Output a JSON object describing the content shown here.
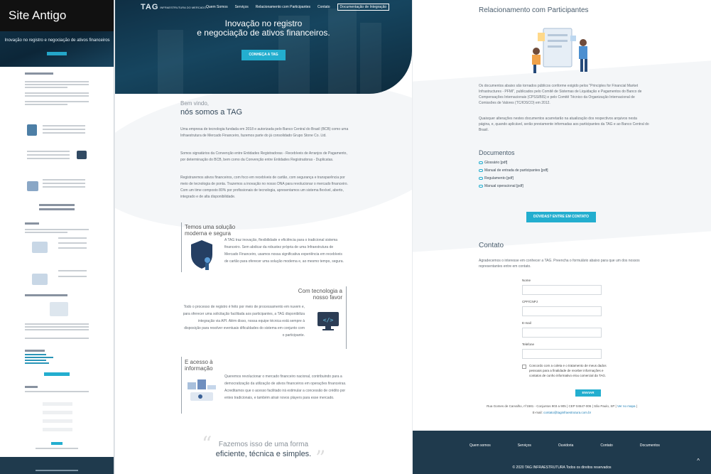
{
  "old_site": {
    "label": "Site Antigo",
    "hero_title": "Inovação no registro e negociação de ativos financeiros"
  },
  "brand": {
    "logo": "TAG",
    "logo_sub": "INFRAESTRUTURA DO MERCADO",
    "accent": "#23aecf",
    "dark": "#1f3a4d"
  },
  "nav": {
    "items": [
      "Quem Somos",
      "Serviços",
      "Relacionamento com Participantes",
      "Contato"
    ],
    "doc_button": "Documentação de Integração"
  },
  "hero": {
    "title_line1": "Inovação no registro",
    "title_line2": "e negociação de ativos financeiros.",
    "cta": "CONHEÇA A TAG"
  },
  "welcome": {
    "kicker": "Bem vindo,",
    "title": "nós somos a TAG",
    "paragraphs": [
      "Uma empresa de tecnologia fundada em 2018 e autorizada pelo Banco Central do Brasil (BCB) como uma Infraestrutura de Mercado Financeiro, fazemos parte do já consolidado Grupo Stone Co. Ltd.",
      "Somos signatários da Convenção entre Entidades Registradoras - Recebíveis de Arranjos de Pagamento, por determinação do BCB, bem como da Convenção entre Entidades Registradoras - Duplicatas.",
      "Registraremos ativos financeiros, com foco em recebíveis de cartão, com segurança e transparência por meio de tecnologia de ponta. Trazemos a inovação no nosso DNA para revolucionar o mercado financeiro. Com um time composto 80% por profissionais de tecnologia, apresentamos um sistema flexível, aberto, integrado e de alta disponibilidade."
    ]
  },
  "features": [
    {
      "title_line1": "Temos uma solução",
      "title_line2": "moderna e segura",
      "text": "A TAG traz inovação, flexibilidade e eficiência para o tradicional sistema financeiro. Sem abdicar da robustez própria de uma Infraestrutura de Mercado Financeiro, usamos nossa significativa experiência em recebíveis de cartão para oferecer uma solução moderna e, ao mesmo tempo, segura.",
      "icon": "shield-icon"
    },
    {
      "title_line1": "Com tecnologia a",
      "title_line2": "nosso favor",
      "text": "Todo o processo de registro é feito por meio de processamento em nuvem e, para oferecer uma solicitação facilitada aos participantes, a TAG disponibiliza integração via API. Além disso, nossa equipe técnica está sempre à disposição para resolver eventuais dificuldades do sistema em conjunto com o participante.",
      "icon": "code-monitor-icon"
    },
    {
      "title_line1": "E acesso à",
      "title_line2": "informação",
      "text": "Queremos revolucionar o mercado financeiro nacional, contribuindo para a democratização da utilização de ativos financeiros em operações financeiras. Acreditamos que o acesso facilitado irá estimular a concessão de crédito por entes tradicionais, e também atrair novos players para esse mercado.",
      "icon": "data-chart-icon"
    }
  ],
  "quote": {
    "line1": "Fazemos isso de uma forma",
    "line2": "eficiente, técnica e simples."
  },
  "relacionamento": {
    "title": "Relacionamento com Participantes",
    "paragraphs": [
      "Os documentos abaixo são tornados públicos conforme exigido pelos \"Principles for Financial Market Infrastructures - PFMI\", publicados pelo Comitê de Sistemas de Liquidação e Pagamentos do Banco de Compensações Internacionais (CPSS/BIS) e pelo Comitê Técnico da Organização Internacional de Comissões de Valores (TC/IOSCO) em 2012.",
      "Quaisquer alterações nestes documentos acarretarão na atualização dos respectivos arquivos nesta página, e, quando aplicável, serão previamente informadas aos participantes da TAG e ao Banco Central do Brasil."
    ]
  },
  "documentos": {
    "title": "Documentos",
    "items": [
      "Glossário [pdf]",
      "Manual de entrada de participantes [pdf]",
      "Regulamento [pdf]",
      "Manual operacional [pdf]"
    ],
    "cta": "DÚVIDAS? ENTRE EM CONTATO"
  },
  "contato": {
    "title": "Contato",
    "intro": "Agradecemos o interesse em conhecer a TAG. Preencha o formulário abaixo para que um dos nossos representantes entre em contato.",
    "fields": [
      "Nome",
      "CPF/CNPJ",
      "E-mail",
      "Telefone"
    ],
    "consent": "Concordo com a coleta e o tratamento de meus dados pessoais para a finalidade de receber informações e contatos de cunho informativo e/ou comercial da TAG.",
    "submit": "ENVIAR",
    "address_main": "Rua Gomes de Carvalho, nº1581 - Conjuntos 903 a 905 | CEP 04547-006 | São Paulo, SP |",
    "map_link": "Ver no mapa",
    "email_label": "E-mail:",
    "email": "contato@taginfraestrutura.com.br"
  },
  "footer": {
    "nav": [
      "Quem somos",
      "Serviços",
      "Ouvidoria",
      "Contato",
      "Documentos"
    ],
    "copyright": "© 2020 TAG INFRAESTRUTURA Todos os direitos reservados"
  }
}
